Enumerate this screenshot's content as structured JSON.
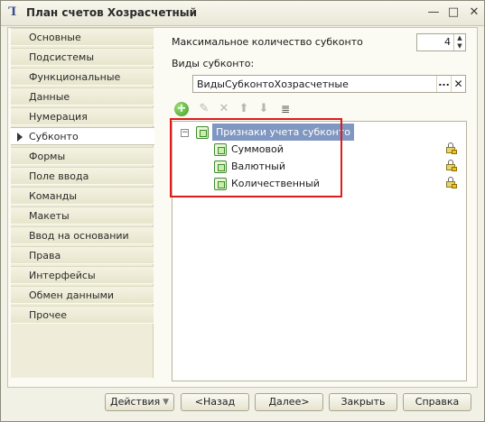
{
  "window": {
    "title": "План счетов Хозрасчетный",
    "app_icon_glyph": "Ꞁ",
    "min_glyph": "—",
    "max_glyph": "□",
    "close_glyph": "✕"
  },
  "sidebar": {
    "items": [
      {
        "label": "Основные"
      },
      {
        "label": "Подсистемы"
      },
      {
        "label": "Функциональные опции"
      },
      {
        "label": "Данные"
      },
      {
        "label": "Нумерация"
      },
      {
        "label": "Субконто",
        "active": true
      },
      {
        "label": "Формы"
      },
      {
        "label": "Поле ввода"
      },
      {
        "label": "Команды"
      },
      {
        "label": "Макеты"
      },
      {
        "label": "Ввод на основании"
      },
      {
        "label": "Права"
      },
      {
        "label": "Интерфейсы"
      },
      {
        "label": "Обмен данными"
      },
      {
        "label": "Прочее"
      }
    ]
  },
  "main": {
    "max_subconto_label": "Максимальное количество субконто",
    "max_subconto_value": "4",
    "subconto_types_label": "Виды субконто:",
    "subconto_types_value": "ВидыСубконтоХозрасчетные",
    "combo_dots": "...",
    "combo_clear": "✕",
    "toolbar": {
      "add": "+",
      "edit": "✎",
      "delete": "✕",
      "up": "⬆",
      "down": "⬇",
      "list": "≣"
    },
    "tree": {
      "collapse_glyph": "−",
      "root": "Признаки учета субконто",
      "children": [
        "Суммовой",
        "Валютный",
        "Количественный"
      ]
    }
  },
  "footer": {
    "actions_label": "Действия",
    "actions_dropdown": "▼",
    "back_label": "<Назад",
    "next_label": "Далее>",
    "close_label": "Закрыть",
    "help_label": "Справка"
  },
  "colors": {
    "highlight_border": "#e01b1b",
    "selected_node_bg": "#7f97c1"
  },
  "icons": [
    "app-icon",
    "minimize-icon",
    "maximize-icon",
    "close-icon",
    "add-icon",
    "edit-icon",
    "delete-icon",
    "move-up-icon",
    "move-down-icon",
    "list-icon",
    "tree-node-icon",
    "lock-icon"
  ]
}
